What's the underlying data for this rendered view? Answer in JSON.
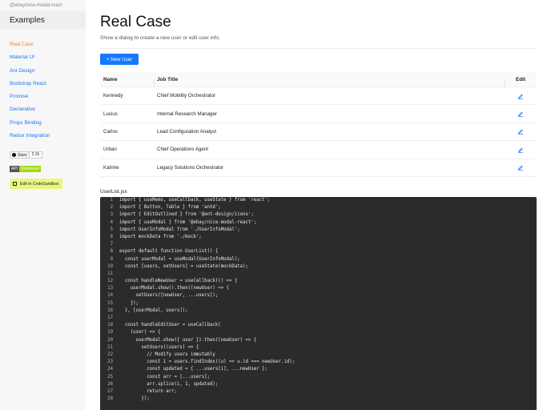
{
  "sidebar": {
    "package_name": "@ebay/nice-modal-react",
    "title": "Examples",
    "items": [
      {
        "label": "Real Case",
        "active": true
      },
      {
        "label": "Material UI"
      },
      {
        "label": "Ant Design"
      },
      {
        "label": "Bootstrap React"
      },
      {
        "label": "Promise"
      },
      {
        "label": "Declarative"
      },
      {
        "label": "Props Binding"
      },
      {
        "label": "Redux Integration"
      }
    ],
    "github_badge": {
      "label": "Stars",
      "count": "2.2k"
    },
    "api_badge": {
      "left": "API",
      "right": "Reference"
    },
    "sandbox_badge": {
      "label": "Edit in CodeSandbox"
    }
  },
  "main": {
    "title": "Real Case",
    "subtitle": "Show a dialog to create a new user or edit user info.",
    "new_button": "+ New User",
    "table": {
      "headers": {
        "name": "Name",
        "job": "Job Title",
        "edit": "Edit"
      },
      "rows": [
        {
          "name": "Kennedy",
          "job": "Chief Mobility Orchestrator"
        },
        {
          "name": "Lucius",
          "job": "Internal Research Manager"
        },
        {
          "name": "Carlos",
          "job": "Lead Configuration Analyst"
        },
        {
          "name": "Urban",
          "job": "Chief Operations Agent"
        },
        {
          "name": "Katrine",
          "job": "Legacy Solutions Orchestrator"
        }
      ]
    },
    "code_filename": "UserList.jsx",
    "code_lines": [
      "import { useMemo, useCallback, useState } from 'react';",
      "import { Button, Table } from 'antd';",
      "import { EditOutlined } from '@ant-design/icons';",
      "import { useModal } from '@ebay/nice-modal-react';",
      "import UserInfoModal from './UserInfoModal';",
      "import mockData from './mock';",
      "",
      "export default function UserList() {",
      "  const userModal = useModal(UserInfoModal);",
      "  const [users, setUsers] = useState(mockData);",
      "",
      "  const handleNewUser = useCallback(() => {",
      "    userModal.show().then((newUser) => {",
      "      setUsers([newUser, ...users]);",
      "    });",
      "  }, [userModal, users]);",
      "",
      "  const handleEditUser = useCallback(",
      "    (user) => {",
      "      userModal.show({ user }).then((newUser) => {",
      "        setUsers((users) => {",
      "          // Modify users immutably",
      "          const i = users.findIndex((u) => u.id === newUser.id);",
      "          const updated = { ...users[i], ...newUser };",
      "          const arr = [...users];",
      "          arr.splice(i, 1, updated);",
      "          return arr;",
      "        });"
    ]
  }
}
